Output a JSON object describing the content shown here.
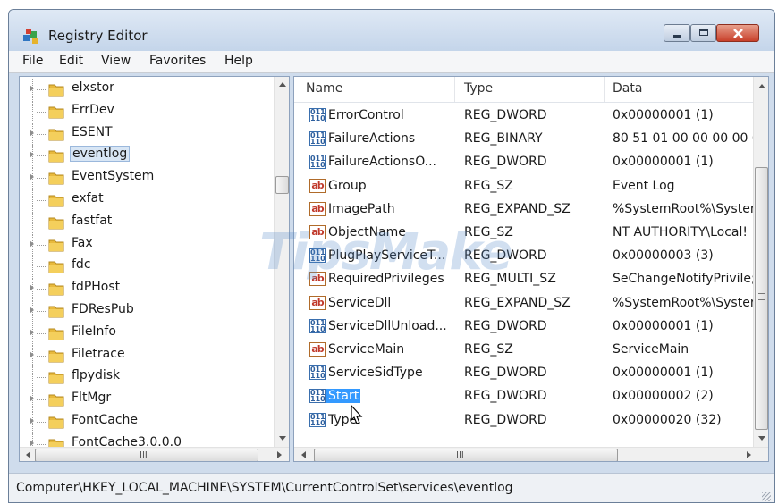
{
  "window": {
    "title": "Registry Editor"
  },
  "menu": [
    "File",
    "Edit",
    "View",
    "Favorites",
    "Help"
  ],
  "tree": {
    "items": [
      {
        "label": "elxstor",
        "expandable": true
      },
      {
        "label": "ErrDev",
        "expandable": false
      },
      {
        "label": "ESENT",
        "expandable": true
      },
      {
        "label": "eventlog",
        "expandable": true,
        "selected": true
      },
      {
        "label": "EventSystem",
        "expandable": true
      },
      {
        "label": "exfat",
        "expandable": false
      },
      {
        "label": "fastfat",
        "expandable": false
      },
      {
        "label": "Fax",
        "expandable": true
      },
      {
        "label": "fdc",
        "expandable": false
      },
      {
        "label": "fdPHost",
        "expandable": true
      },
      {
        "label": "FDResPub",
        "expandable": true
      },
      {
        "label": "FileInfo",
        "expandable": true
      },
      {
        "label": "Filetrace",
        "expandable": true
      },
      {
        "label": "flpydisk",
        "expandable": false
      },
      {
        "label": "FltMgr",
        "expandable": true
      },
      {
        "label": "FontCache",
        "expandable": true
      },
      {
        "label": "FontCache3.0.0.0",
        "expandable": true
      }
    ],
    "hscroll_grip": "III"
  },
  "list": {
    "columns": {
      "name": "Name",
      "type": "Type",
      "data": "Data"
    },
    "rows": [
      {
        "icon": "binary-value-icon",
        "name": "ErrorControl",
        "type": "REG_DWORD",
        "data": "0x00000001 (1)"
      },
      {
        "icon": "binary-value-icon",
        "name": "FailureActions",
        "type": "REG_BINARY",
        "data": "80 51 01 00 00 00 00 00"
      },
      {
        "icon": "binary-value-icon",
        "name": "FailureActionsO...",
        "type": "REG_DWORD",
        "data": "0x00000001 (1)"
      },
      {
        "icon": "string-value-icon",
        "name": "Group",
        "type": "REG_SZ",
        "data": "Event Log"
      },
      {
        "icon": "string-value-icon",
        "name": "ImagePath",
        "type": "REG_EXPAND_SZ",
        "data": "%SystemRoot%\\Syster"
      },
      {
        "icon": "string-value-icon",
        "name": "ObjectName",
        "type": "REG_SZ",
        "data": "NT AUTHORITY\\Local!"
      },
      {
        "icon": "binary-value-icon",
        "name": "PlugPlayServiceT...",
        "type": "REG_DWORD",
        "data": "0x00000003 (3)"
      },
      {
        "icon": "string-value-icon",
        "name": "RequiredPrivileges",
        "type": "REG_MULTI_SZ",
        "data": "SeChangeNotifyPrivile;"
      },
      {
        "icon": "string-value-icon",
        "name": "ServiceDll",
        "type": "REG_EXPAND_SZ",
        "data": "%SystemRoot%\\Syster"
      },
      {
        "icon": "binary-value-icon",
        "name": "ServiceDllUnload...",
        "type": "REG_DWORD",
        "data": "0x00000001 (1)"
      },
      {
        "icon": "string-value-icon",
        "name": "ServiceMain",
        "type": "REG_SZ",
        "data": "ServiceMain"
      },
      {
        "icon": "binary-value-icon",
        "name": "ServiceSidType",
        "type": "REG_DWORD",
        "data": "0x00000001 (1)"
      },
      {
        "icon": "binary-value-icon",
        "name": "Start",
        "type": "REG_DWORD",
        "data": "0x00000002 (2)",
        "selected": true
      },
      {
        "icon": "binary-value-icon",
        "name": "Type",
        "type": "REG_DWORD",
        "data": "0x00000020 (32)"
      }
    ],
    "hscroll_grip": "III"
  },
  "icon_glyphs": {
    "string": "ab",
    "binary": "011 110"
  },
  "status": {
    "path": "Computer\\HKEY_LOCAL_MACHINE\\SYSTEM\\CurrentControlSet\\services\\eventlog"
  },
  "watermark": "TipsMake",
  "colors": {
    "selection": "#3399ff",
    "tree_selection": "#d8e6f5",
    "close_button": "#c8402a",
    "folder": "#e8b93c"
  }
}
